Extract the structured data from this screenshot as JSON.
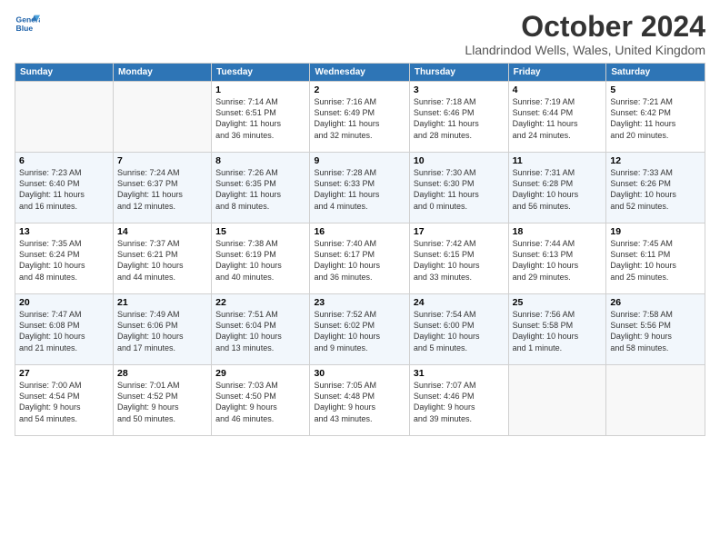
{
  "header": {
    "logo_line1": "General",
    "logo_line2": "Blue",
    "month": "October 2024",
    "location": "Llandrindod Wells, Wales, United Kingdom"
  },
  "weekdays": [
    "Sunday",
    "Monday",
    "Tuesday",
    "Wednesday",
    "Thursday",
    "Friday",
    "Saturday"
  ],
  "weeks": [
    [
      {
        "day": "",
        "info": ""
      },
      {
        "day": "",
        "info": ""
      },
      {
        "day": "1",
        "info": "Sunrise: 7:14 AM\nSunset: 6:51 PM\nDaylight: 11 hours\nand 36 minutes."
      },
      {
        "day": "2",
        "info": "Sunrise: 7:16 AM\nSunset: 6:49 PM\nDaylight: 11 hours\nand 32 minutes."
      },
      {
        "day": "3",
        "info": "Sunrise: 7:18 AM\nSunset: 6:46 PM\nDaylight: 11 hours\nand 28 minutes."
      },
      {
        "day": "4",
        "info": "Sunrise: 7:19 AM\nSunset: 6:44 PM\nDaylight: 11 hours\nand 24 minutes."
      },
      {
        "day": "5",
        "info": "Sunrise: 7:21 AM\nSunset: 6:42 PM\nDaylight: 11 hours\nand 20 minutes."
      }
    ],
    [
      {
        "day": "6",
        "info": "Sunrise: 7:23 AM\nSunset: 6:40 PM\nDaylight: 11 hours\nand 16 minutes."
      },
      {
        "day": "7",
        "info": "Sunrise: 7:24 AM\nSunset: 6:37 PM\nDaylight: 11 hours\nand 12 minutes."
      },
      {
        "day": "8",
        "info": "Sunrise: 7:26 AM\nSunset: 6:35 PM\nDaylight: 11 hours\nand 8 minutes."
      },
      {
        "day": "9",
        "info": "Sunrise: 7:28 AM\nSunset: 6:33 PM\nDaylight: 11 hours\nand 4 minutes."
      },
      {
        "day": "10",
        "info": "Sunrise: 7:30 AM\nSunset: 6:30 PM\nDaylight: 11 hours\nand 0 minutes."
      },
      {
        "day": "11",
        "info": "Sunrise: 7:31 AM\nSunset: 6:28 PM\nDaylight: 10 hours\nand 56 minutes."
      },
      {
        "day": "12",
        "info": "Sunrise: 7:33 AM\nSunset: 6:26 PM\nDaylight: 10 hours\nand 52 minutes."
      }
    ],
    [
      {
        "day": "13",
        "info": "Sunrise: 7:35 AM\nSunset: 6:24 PM\nDaylight: 10 hours\nand 48 minutes."
      },
      {
        "day": "14",
        "info": "Sunrise: 7:37 AM\nSunset: 6:21 PM\nDaylight: 10 hours\nand 44 minutes."
      },
      {
        "day": "15",
        "info": "Sunrise: 7:38 AM\nSunset: 6:19 PM\nDaylight: 10 hours\nand 40 minutes."
      },
      {
        "day": "16",
        "info": "Sunrise: 7:40 AM\nSunset: 6:17 PM\nDaylight: 10 hours\nand 36 minutes."
      },
      {
        "day": "17",
        "info": "Sunrise: 7:42 AM\nSunset: 6:15 PM\nDaylight: 10 hours\nand 33 minutes."
      },
      {
        "day": "18",
        "info": "Sunrise: 7:44 AM\nSunset: 6:13 PM\nDaylight: 10 hours\nand 29 minutes."
      },
      {
        "day": "19",
        "info": "Sunrise: 7:45 AM\nSunset: 6:11 PM\nDaylight: 10 hours\nand 25 minutes."
      }
    ],
    [
      {
        "day": "20",
        "info": "Sunrise: 7:47 AM\nSunset: 6:08 PM\nDaylight: 10 hours\nand 21 minutes."
      },
      {
        "day": "21",
        "info": "Sunrise: 7:49 AM\nSunset: 6:06 PM\nDaylight: 10 hours\nand 17 minutes."
      },
      {
        "day": "22",
        "info": "Sunrise: 7:51 AM\nSunset: 6:04 PM\nDaylight: 10 hours\nand 13 minutes."
      },
      {
        "day": "23",
        "info": "Sunrise: 7:52 AM\nSunset: 6:02 PM\nDaylight: 10 hours\nand 9 minutes."
      },
      {
        "day": "24",
        "info": "Sunrise: 7:54 AM\nSunset: 6:00 PM\nDaylight: 10 hours\nand 5 minutes."
      },
      {
        "day": "25",
        "info": "Sunrise: 7:56 AM\nSunset: 5:58 PM\nDaylight: 10 hours\nand 1 minute."
      },
      {
        "day": "26",
        "info": "Sunrise: 7:58 AM\nSunset: 5:56 PM\nDaylight: 9 hours\nand 58 minutes."
      }
    ],
    [
      {
        "day": "27",
        "info": "Sunrise: 7:00 AM\nSunset: 4:54 PM\nDaylight: 9 hours\nand 54 minutes."
      },
      {
        "day": "28",
        "info": "Sunrise: 7:01 AM\nSunset: 4:52 PM\nDaylight: 9 hours\nand 50 minutes."
      },
      {
        "day": "29",
        "info": "Sunrise: 7:03 AM\nSunset: 4:50 PM\nDaylight: 9 hours\nand 46 minutes."
      },
      {
        "day": "30",
        "info": "Sunrise: 7:05 AM\nSunset: 4:48 PM\nDaylight: 9 hours\nand 43 minutes."
      },
      {
        "day": "31",
        "info": "Sunrise: 7:07 AM\nSunset: 4:46 PM\nDaylight: 9 hours\nand 39 minutes."
      },
      {
        "day": "",
        "info": ""
      },
      {
        "day": "",
        "info": ""
      }
    ]
  ]
}
